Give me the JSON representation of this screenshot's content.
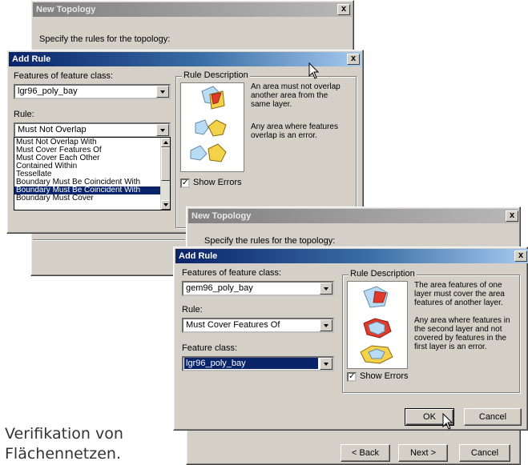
{
  "colors": {
    "dialog_face": "#d4d0c8",
    "titlebar_active": "#0a246a",
    "selection": "#0a246a",
    "titlebar_inactive": "#808080"
  },
  "topology_back": {
    "title": "New Topology",
    "close_glyph": "x",
    "instruction": "Specify the rules for the topology:"
  },
  "add_rule_1": {
    "title": "Add Rule",
    "close_glyph": "x",
    "feature_class_label": "Features of feature class:",
    "feature_class_value": "lgr96_poly_bay",
    "rule_label": "Rule:",
    "rule_value": "Must Not Overlap",
    "rule_options": [
      "Must Not Overlap With",
      "Must Cover Features Of",
      "Must Cover Each Other",
      "Contained Within",
      "Tessellate",
      "Boundary Must Be Coincident With",
      "Boundary Must Be Coincident With",
      "Boundary Must Cover"
    ],
    "selected_option_index": 6,
    "group_title": "Rule Description",
    "desc_1": "An area must not overlap another area from the same layer.",
    "desc_2": "Any area where features overlap is an error.",
    "show_errors_label": "Show Errors",
    "show_errors_checked": true
  },
  "topology_front": {
    "title": "New Topology",
    "close_glyph": "x",
    "instruction": "Specify the rules for the topology:",
    "back_label": "< Back",
    "next_label": "Next >",
    "cancel_label": "Cancel"
  },
  "add_rule_2": {
    "title": "Add Rule",
    "close_glyph": "x",
    "feature_class_label": "Features of feature class:",
    "feature_class_value": "gem96_poly_bay",
    "rule_label": "Rule:",
    "rule_value": "Must Cover Features Of",
    "feature_class2_label": "Feature class:",
    "feature_class2_value": "lgr96_poly_bay",
    "group_title": "Rule Description",
    "desc_1": "The area features of one layer must cover the area features of another layer.",
    "desc_2": "Any area where features in the second layer and not covered by features in the first layer is an error.",
    "show_errors_label": "Show Errors",
    "show_errors_checked": true,
    "ok_label": "OK",
    "cancel_label": "Cancel"
  },
  "caption": {
    "line1": "Verifikation von",
    "line2": "Flächennetzen."
  }
}
